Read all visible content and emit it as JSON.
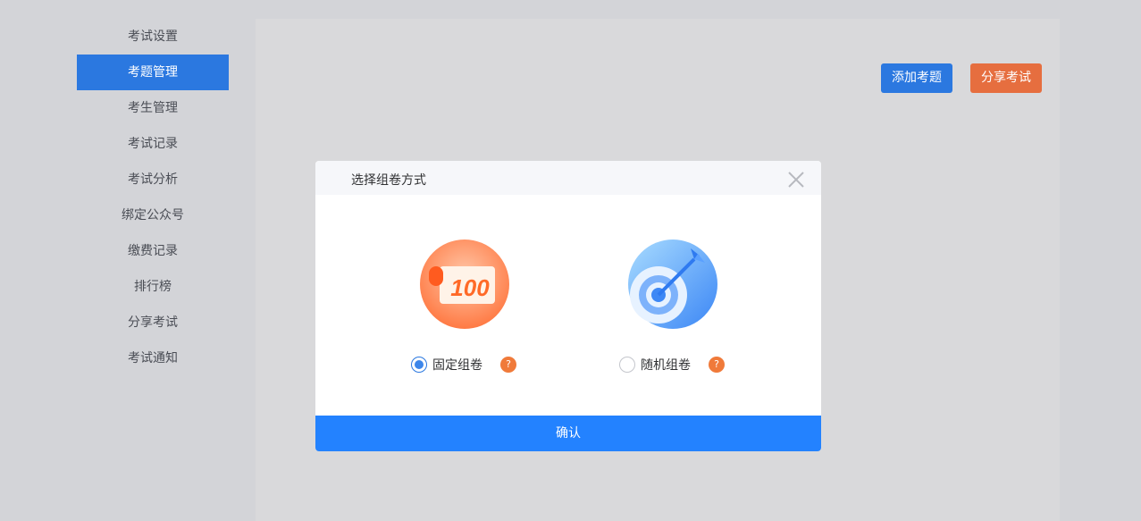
{
  "sidebar": {
    "items": [
      {
        "label": "考试设置",
        "active": false
      },
      {
        "label": "考题管理",
        "active": true
      },
      {
        "label": "考生管理",
        "active": false
      },
      {
        "label": "考试记录",
        "active": false
      },
      {
        "label": "考试分析",
        "active": false
      },
      {
        "label": "绑定公众号",
        "active": false
      },
      {
        "label": "缴费记录",
        "active": false
      },
      {
        "label": "排行榜",
        "active": false
      },
      {
        "label": "分享考试",
        "active": false
      },
      {
        "label": "考试通知",
        "active": false
      }
    ]
  },
  "toolbar": {
    "add_label": "添加考题",
    "share_label": "分享考试"
  },
  "modal": {
    "title": "选择组卷方式",
    "options": [
      {
        "label": "固定组卷",
        "checked": true,
        "icon": "score-100-icon",
        "help": "?"
      },
      {
        "label": "随机组卷",
        "checked": false,
        "icon": "target-icon",
        "help": "?"
      }
    ],
    "illustration_text": "100",
    "confirm_label": "确认"
  },
  "colors": {
    "primary": "#2b78e0",
    "confirm": "#2382ff",
    "accent_orange": "#e66e3f",
    "help_orange": "#f07a3a"
  }
}
